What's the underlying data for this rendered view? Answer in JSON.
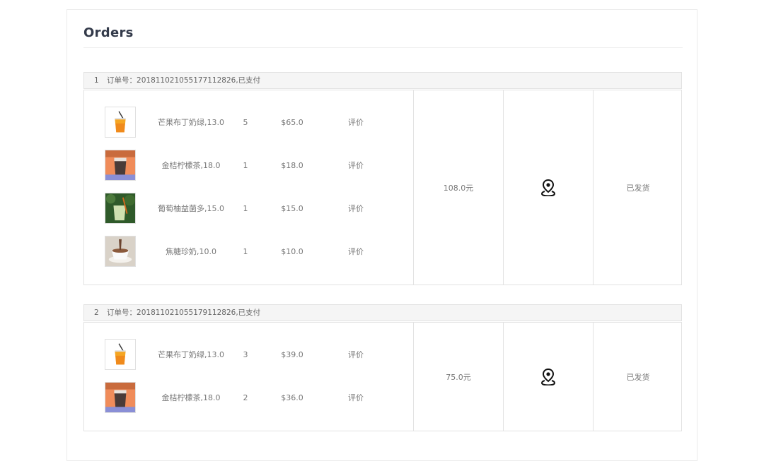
{
  "page_title": "Orders",
  "orders": [
    {
      "index": "1",
      "header": "订单号：20181102105517711282​6,已支付",
      "items": [
        {
          "thumb": "mango-drink-icon",
          "name": "芒果布丁奶绿,13.0",
          "qty": "5",
          "price": "$65.0",
          "review": "评价"
        },
        {
          "thumb": "kumquat-tea-icon",
          "name": "金桔柠檬茶,18.0",
          "qty": "1",
          "price": "$18.0",
          "review": "评价"
        },
        {
          "thumb": "grape-yakult-icon",
          "name": "葡萄柚益菌多,15.0",
          "qty": "1",
          "price": "$15.0",
          "review": "评价"
        },
        {
          "thumb": "boba-milk-icon",
          "name": "焦糖珍奶,10.0",
          "qty": "1",
          "price": "$10.0",
          "review": "评价"
        }
      ],
      "total": "108.0元",
      "address_icon": "location-pin-icon",
      "status": "已发货"
    },
    {
      "index": "2",
      "header": "订单号：20181102105517911282​6,已支付",
      "items": [
        {
          "thumb": "mango-drink-icon",
          "name": "芒果布丁奶绿,13.0",
          "qty": "3",
          "price": "$39.0",
          "review": "评价"
        },
        {
          "thumb": "kumquat-tea-icon",
          "name": "金桔柠檬茶,18.0",
          "qty": "2",
          "price": "$36.0",
          "review": "评价"
        }
      ],
      "total": "75.0元",
      "address_icon": "location-pin-icon",
      "status": "已发货"
    }
  ],
  "colors": {
    "title": "#333a4a",
    "header_bg": "#f5f5f5",
    "border": "#e2e2e2",
    "text": "#777777"
  }
}
